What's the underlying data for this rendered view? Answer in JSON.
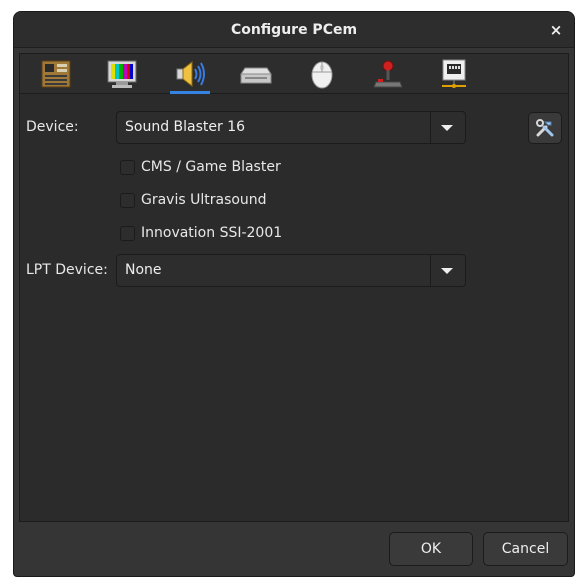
{
  "window": {
    "title": "Configure PCem",
    "close_symbol": "×"
  },
  "tabs": [
    {
      "icon": "motherboard-icon"
    },
    {
      "icon": "display-icon"
    },
    {
      "icon": "speaker-icon",
      "active": true
    },
    {
      "icon": "hard-drive-icon"
    },
    {
      "icon": "mouse-icon"
    },
    {
      "icon": "joystick-icon"
    },
    {
      "icon": "network-icon"
    }
  ],
  "sound": {
    "device_label": "Device:",
    "device_value": "Sound Blaster 16",
    "config_icon": "tools-icon",
    "options": [
      {
        "label": "CMS / Game Blaster",
        "checked": false
      },
      {
        "label": "Gravis Ultrasound",
        "checked": false
      },
      {
        "label": "Innovation SSI-2001",
        "checked": false
      }
    ],
    "lpt_label": "LPT Device:",
    "lpt_value": "None"
  },
  "buttons": {
    "ok": "OK",
    "cancel": "Cancel"
  },
  "colors": {
    "accent": "#3584e4",
    "window_bg": "#353535",
    "panel_bg": "#2b2b2b"
  }
}
